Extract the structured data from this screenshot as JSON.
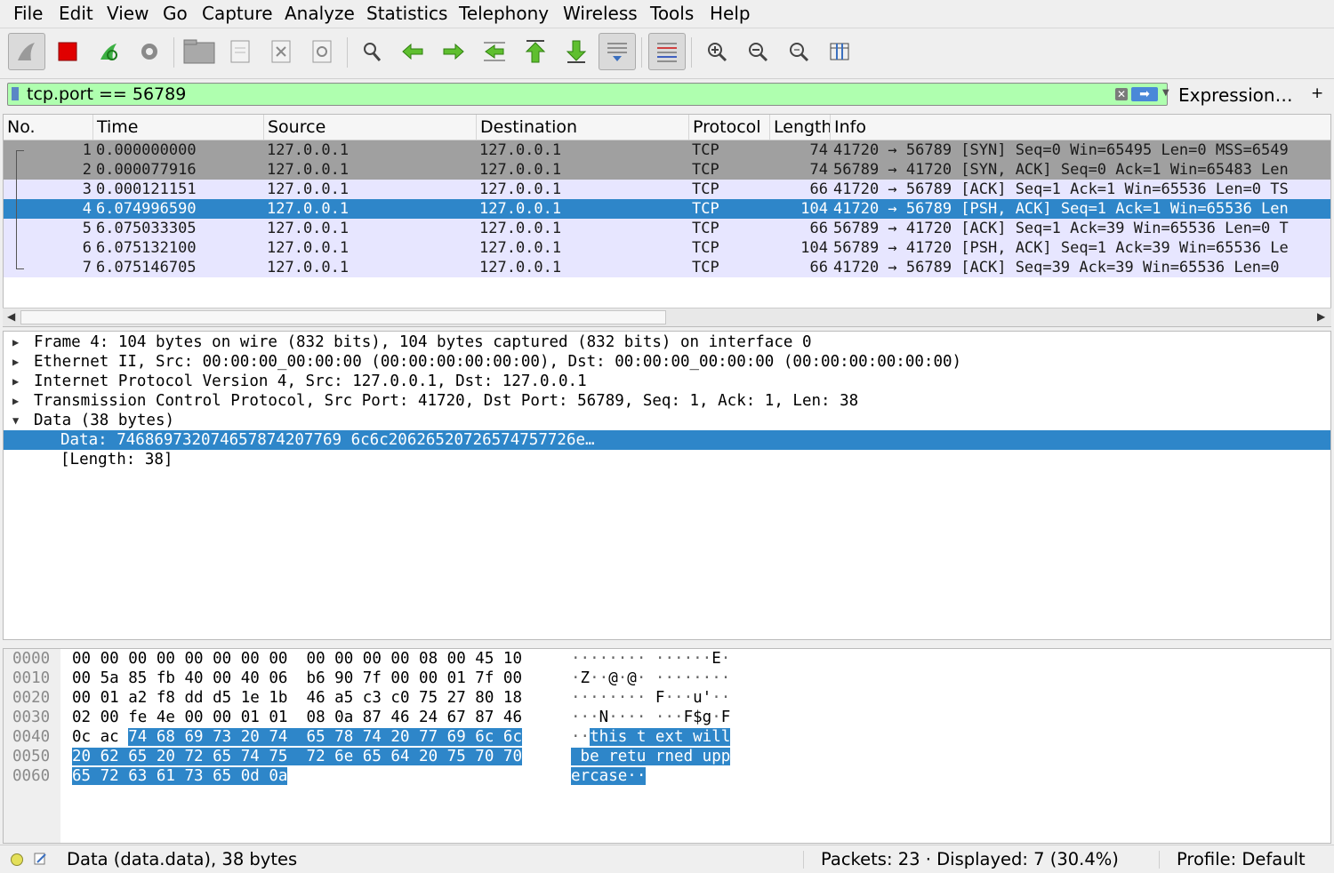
{
  "menu": [
    {
      "label": "File"
    },
    {
      "label": "Edit"
    },
    {
      "label": "View"
    },
    {
      "label": "Go"
    },
    {
      "label": "Capture"
    },
    {
      "label": "Analyze"
    },
    {
      "label": "Statistics"
    },
    {
      "label": "Telephony"
    },
    {
      "label": "Wireless"
    },
    {
      "label": "Tools"
    },
    {
      "label": "Help"
    }
  ],
  "toolbar": {
    "icons": [
      "shark-fin-icon",
      "stop-icon",
      "restart-icon",
      "capture-options-icon",
      "open-folder-icon",
      "save-icon",
      "close-file-icon",
      "reload-icon",
      "find-icon",
      "go-back-icon",
      "go-forward-icon",
      "go-to-packet-icon",
      "first-packet-icon",
      "last-packet-icon",
      "auto-scroll-icon",
      "colorize-icon",
      "zoom-in-icon",
      "zoom-out-icon",
      "zoom-normal-icon",
      "resize-columns-icon"
    ]
  },
  "filter": {
    "value": "tcp.port == 56789",
    "expression_label": "Expression…",
    "add_label": "+",
    "background": "#afffaf"
  },
  "packet_list": {
    "columns": [
      "No.",
      "Time",
      "Source",
      "Destination",
      "Protocol",
      "Length",
      "Info"
    ],
    "rows": [
      {
        "no": "1",
        "time": "0.000000000",
        "src": "127.0.0.1",
        "dst": "127.0.0.1",
        "proto": "TCP",
        "len": "74",
        "info": "41720 → 56789 [SYN] Seq=0 Win=65495 Len=0 MSS=6549",
        "style": "gray"
      },
      {
        "no": "2",
        "time": "0.000077916",
        "src": "127.0.0.1",
        "dst": "127.0.0.1",
        "proto": "TCP",
        "len": "74",
        "info": "56789 → 41720 [SYN, ACK] Seq=0 Ack=1 Win=65483 Len",
        "style": "gray"
      },
      {
        "no": "3",
        "time": "0.000121151",
        "src": "127.0.0.1",
        "dst": "127.0.0.1",
        "proto": "TCP",
        "len": "66",
        "info": "41720 → 56789 [ACK] Seq=1 Ack=1 Win=65536 Len=0 TS",
        "style": "lav"
      },
      {
        "no": "4",
        "time": "6.074996590",
        "src": "127.0.0.1",
        "dst": "127.0.0.1",
        "proto": "TCP",
        "len": "104",
        "info": "41720 → 56789 [PSH, ACK] Seq=1 Ack=1 Win=65536 Len",
        "style": "sel"
      },
      {
        "no": "5",
        "time": "6.075033305",
        "src": "127.0.0.1",
        "dst": "127.0.0.1",
        "proto": "TCP",
        "len": "66",
        "info": "56789 → 41720 [ACK] Seq=1 Ack=39 Win=65536 Len=0 T",
        "style": "lav"
      },
      {
        "no": "6",
        "time": "6.075132100",
        "src": "127.0.0.1",
        "dst": "127.0.0.1",
        "proto": "TCP",
        "len": "104",
        "info": "56789 → 41720 [PSH, ACK] Seq=1 Ack=39 Win=65536 Le",
        "style": "lav"
      },
      {
        "no": "7",
        "time": "6.075146705",
        "src": "127.0.0.1",
        "dst": "127.0.0.1",
        "proto": "TCP",
        "len": "66",
        "info": "41720 → 56789 [ACK] Seq=39 Ack=39 Win=65536 Len=0",
        "style": "lav"
      }
    ]
  },
  "details": [
    {
      "text": "Frame 4: 104 bytes on wire (832 bits), 104 bytes captured (832 bits) on interface 0",
      "expanded": false,
      "child": false,
      "selected": false
    },
    {
      "text": "Ethernet II, Src: 00:00:00_00:00:00 (00:00:00:00:00:00), Dst: 00:00:00_00:00:00 (00:00:00:00:00:00)",
      "expanded": false,
      "child": false,
      "selected": false
    },
    {
      "text": "Internet Protocol Version 4, Src: 127.0.0.1, Dst: 127.0.0.1",
      "expanded": false,
      "child": false,
      "selected": false
    },
    {
      "text": "Transmission Control Protocol, Src Port: 41720, Dst Port: 56789, Seq: 1, Ack: 1, Len: 38",
      "expanded": false,
      "child": false,
      "selected": false
    },
    {
      "text": "Data (38 bytes)",
      "expanded": true,
      "child": false,
      "selected": false
    },
    {
      "text": "Data: 746869732074657874207769 6c6c20626520726574757726e…",
      "expanded": null,
      "child": true,
      "selected": true
    },
    {
      "text": "[Length: 38]",
      "expanded": null,
      "child": true,
      "selected": false
    }
  ],
  "bytes": {
    "offsets": [
      "0000",
      "0010",
      "0020",
      "0030",
      "0040",
      "0050",
      "0060"
    ],
    "rows": [
      {
        "hex": [
          "00",
          "00",
          "00",
          "00",
          "00",
          "00",
          "00",
          "00",
          "00",
          "00",
          "00",
          "00",
          "08",
          "00",
          "45",
          "10"
        ],
        "ascii": "········ ······E·"
      },
      {
        "hex": [
          "00",
          "5a",
          "85",
          "fb",
          "40",
          "00",
          "40",
          "06",
          "b6",
          "90",
          "7f",
          "00",
          "00",
          "01",
          "7f",
          "00"
        ],
        "ascii": "·Z··@·@· ········"
      },
      {
        "hex": [
          "00",
          "01",
          "a2",
          "f8",
          "dd",
          "d5",
          "1e",
          "1b",
          "46",
          "a5",
          "c3",
          "c0",
          "75",
          "27",
          "80",
          "18"
        ],
        "ascii": "········ F···u'··"
      },
      {
        "hex": [
          "02",
          "00",
          "fe",
          "4e",
          "00",
          "00",
          "01",
          "01",
          "08",
          "0a",
          "87",
          "46",
          "24",
          "67",
          "87",
          "46"
        ],
        "ascii": "···N···· ···F$g·F"
      },
      {
        "hex": [
          "0c",
          "ac",
          "74",
          "68",
          "69",
          "73",
          "20",
          "74",
          "65",
          "78",
          "74",
          "20",
          "77",
          "69",
          "6c",
          "6c"
        ],
        "ascii": "··this t ext will"
      },
      {
        "hex": [
          "20",
          "62",
          "65",
          "20",
          "72",
          "65",
          "74",
          "75",
          "72",
          "6e",
          "65",
          "64",
          "20",
          "75",
          "70",
          "70"
        ],
        "ascii": " be retu rned upp"
      },
      {
        "hex": [
          "65",
          "72",
          "63",
          "61",
          "73",
          "65",
          "0d",
          "0a"
        ],
        "ascii": "ercase··"
      }
    ],
    "highlight_start": 66,
    "highlight_end": 104
  },
  "status": {
    "field": "Data (data.data), 38 bytes",
    "packets": "Packets: 23 · Displayed: 7 (30.4%)",
    "profile": "Profile: Default"
  },
  "colors": {
    "selected": "#2e86c9",
    "tcp_row": "#e7e6ff",
    "syn_row": "#a0a0a0",
    "filter_ok": "#afffaf"
  }
}
